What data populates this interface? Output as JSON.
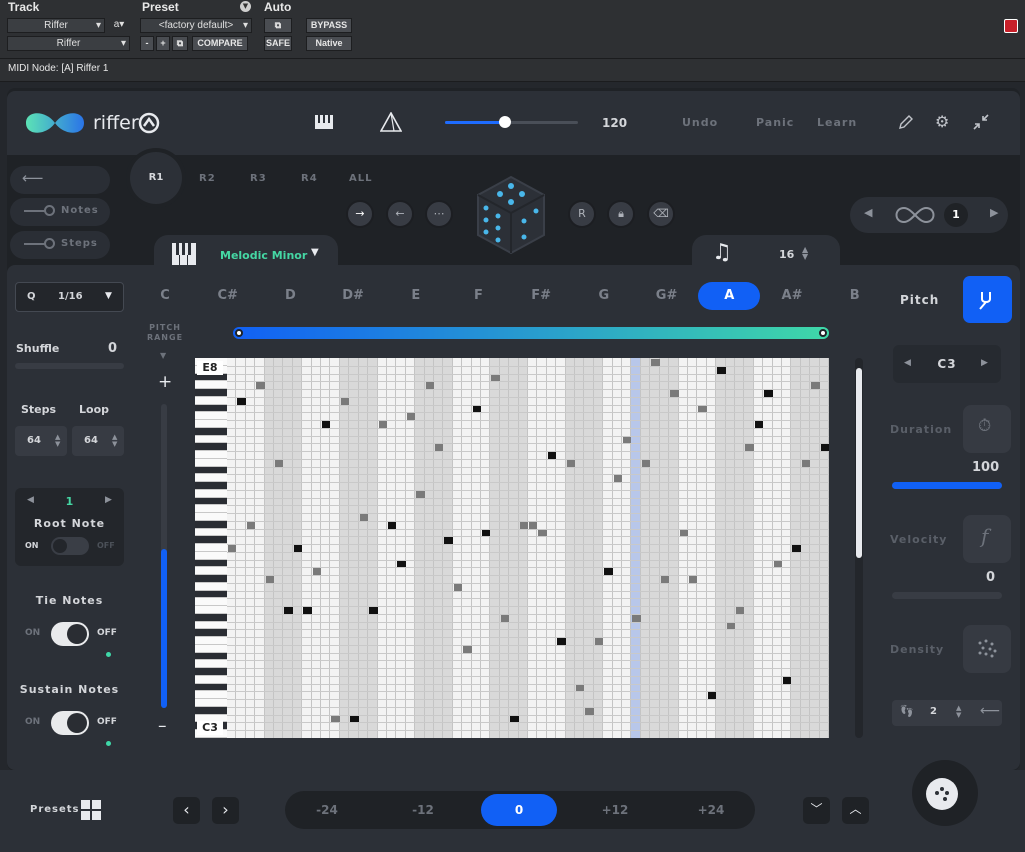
{
  "host": {
    "track_header": "Track",
    "preset_header": "Preset",
    "auto_header": "Auto",
    "track_name": "Riffer",
    "track_suffix": "a",
    "insert_name": "Riffer",
    "preset_value": "<factory default>",
    "minus": "-",
    "plus": "+",
    "compare": "COMPARE",
    "safe": "SAFE",
    "bypass": "BYPASS",
    "native": "Native",
    "midi_node": "MIDI Node: [A] Riffer 1"
  },
  "top": {
    "logo": "riffer",
    "tempo": "120",
    "tempo_fraction": 0.45,
    "undo": "Undo",
    "panic": "Panic",
    "learn": "Learn"
  },
  "riffs": [
    "R1",
    "R2",
    "R3",
    "R4",
    "ALL"
  ],
  "left_toggles": {
    "notes": "Notes",
    "steps": "Steps"
  },
  "scale": {
    "name": "Melodic Minor"
  },
  "steps_top": {
    "value": "16"
  },
  "loop": {
    "value": "1"
  },
  "notes": [
    "C",
    "C#",
    "D",
    "D#",
    "E",
    "F",
    "F#",
    "G",
    "G#",
    "A",
    "A#",
    "B"
  ],
  "selected_note": "A",
  "side": {
    "quantize_label": "Q",
    "quantize_value": "1/16",
    "shuffle_label": "Shuffle",
    "shuffle_value": "0",
    "steps_label": "Steps",
    "loop_label": "Loop",
    "steps_value": "64",
    "loop_value": "64",
    "root_value": "1",
    "root_label": "Root Note",
    "on": "ON",
    "off": "OFF",
    "tie_label": "Tie Notes",
    "sustain_label": "Sustain Notes"
  },
  "pitch_range": {
    "label_line1": "PITCH",
    "label_line2": "RANGE",
    "plus": "+",
    "minus": "–"
  },
  "grid": {
    "top_label": "E8",
    "bottom_label": "C3"
  },
  "right": {
    "pitch": "Pitch",
    "pitch_value": "C3",
    "duration": "Duration",
    "duration_value": "100",
    "duration_fraction": 1.0,
    "velocity": "Velocity",
    "velocity_value": "0",
    "velocity_glyph": "f",
    "density": "Density",
    "density_value": "2"
  },
  "bottom": {
    "presets": "Presets",
    "octaves": [
      "-24",
      "-12",
      "0",
      "+12",
      "+24"
    ],
    "selected_octave": "0"
  },
  "colors": {
    "accent": "#1160f5",
    "teal": "#3fd8a8",
    "bg": "#1f2226",
    "panel": "#2c3037"
  },
  "icons": [
    "piano-icon",
    "triangle-icon",
    "pencil-icon",
    "gear-icon",
    "collapse-icon",
    "back-arrow-icon",
    "dice-icon",
    "note-icon",
    "loop-icon",
    "tuning-fork-icon",
    "stopwatch-icon",
    "dots-icon",
    "presets-grid-icon",
    "chevron-left-icon",
    "chevron-right-icon",
    "chevron-down-icon",
    "chevron-up-icon",
    "palette-icon"
  ]
}
